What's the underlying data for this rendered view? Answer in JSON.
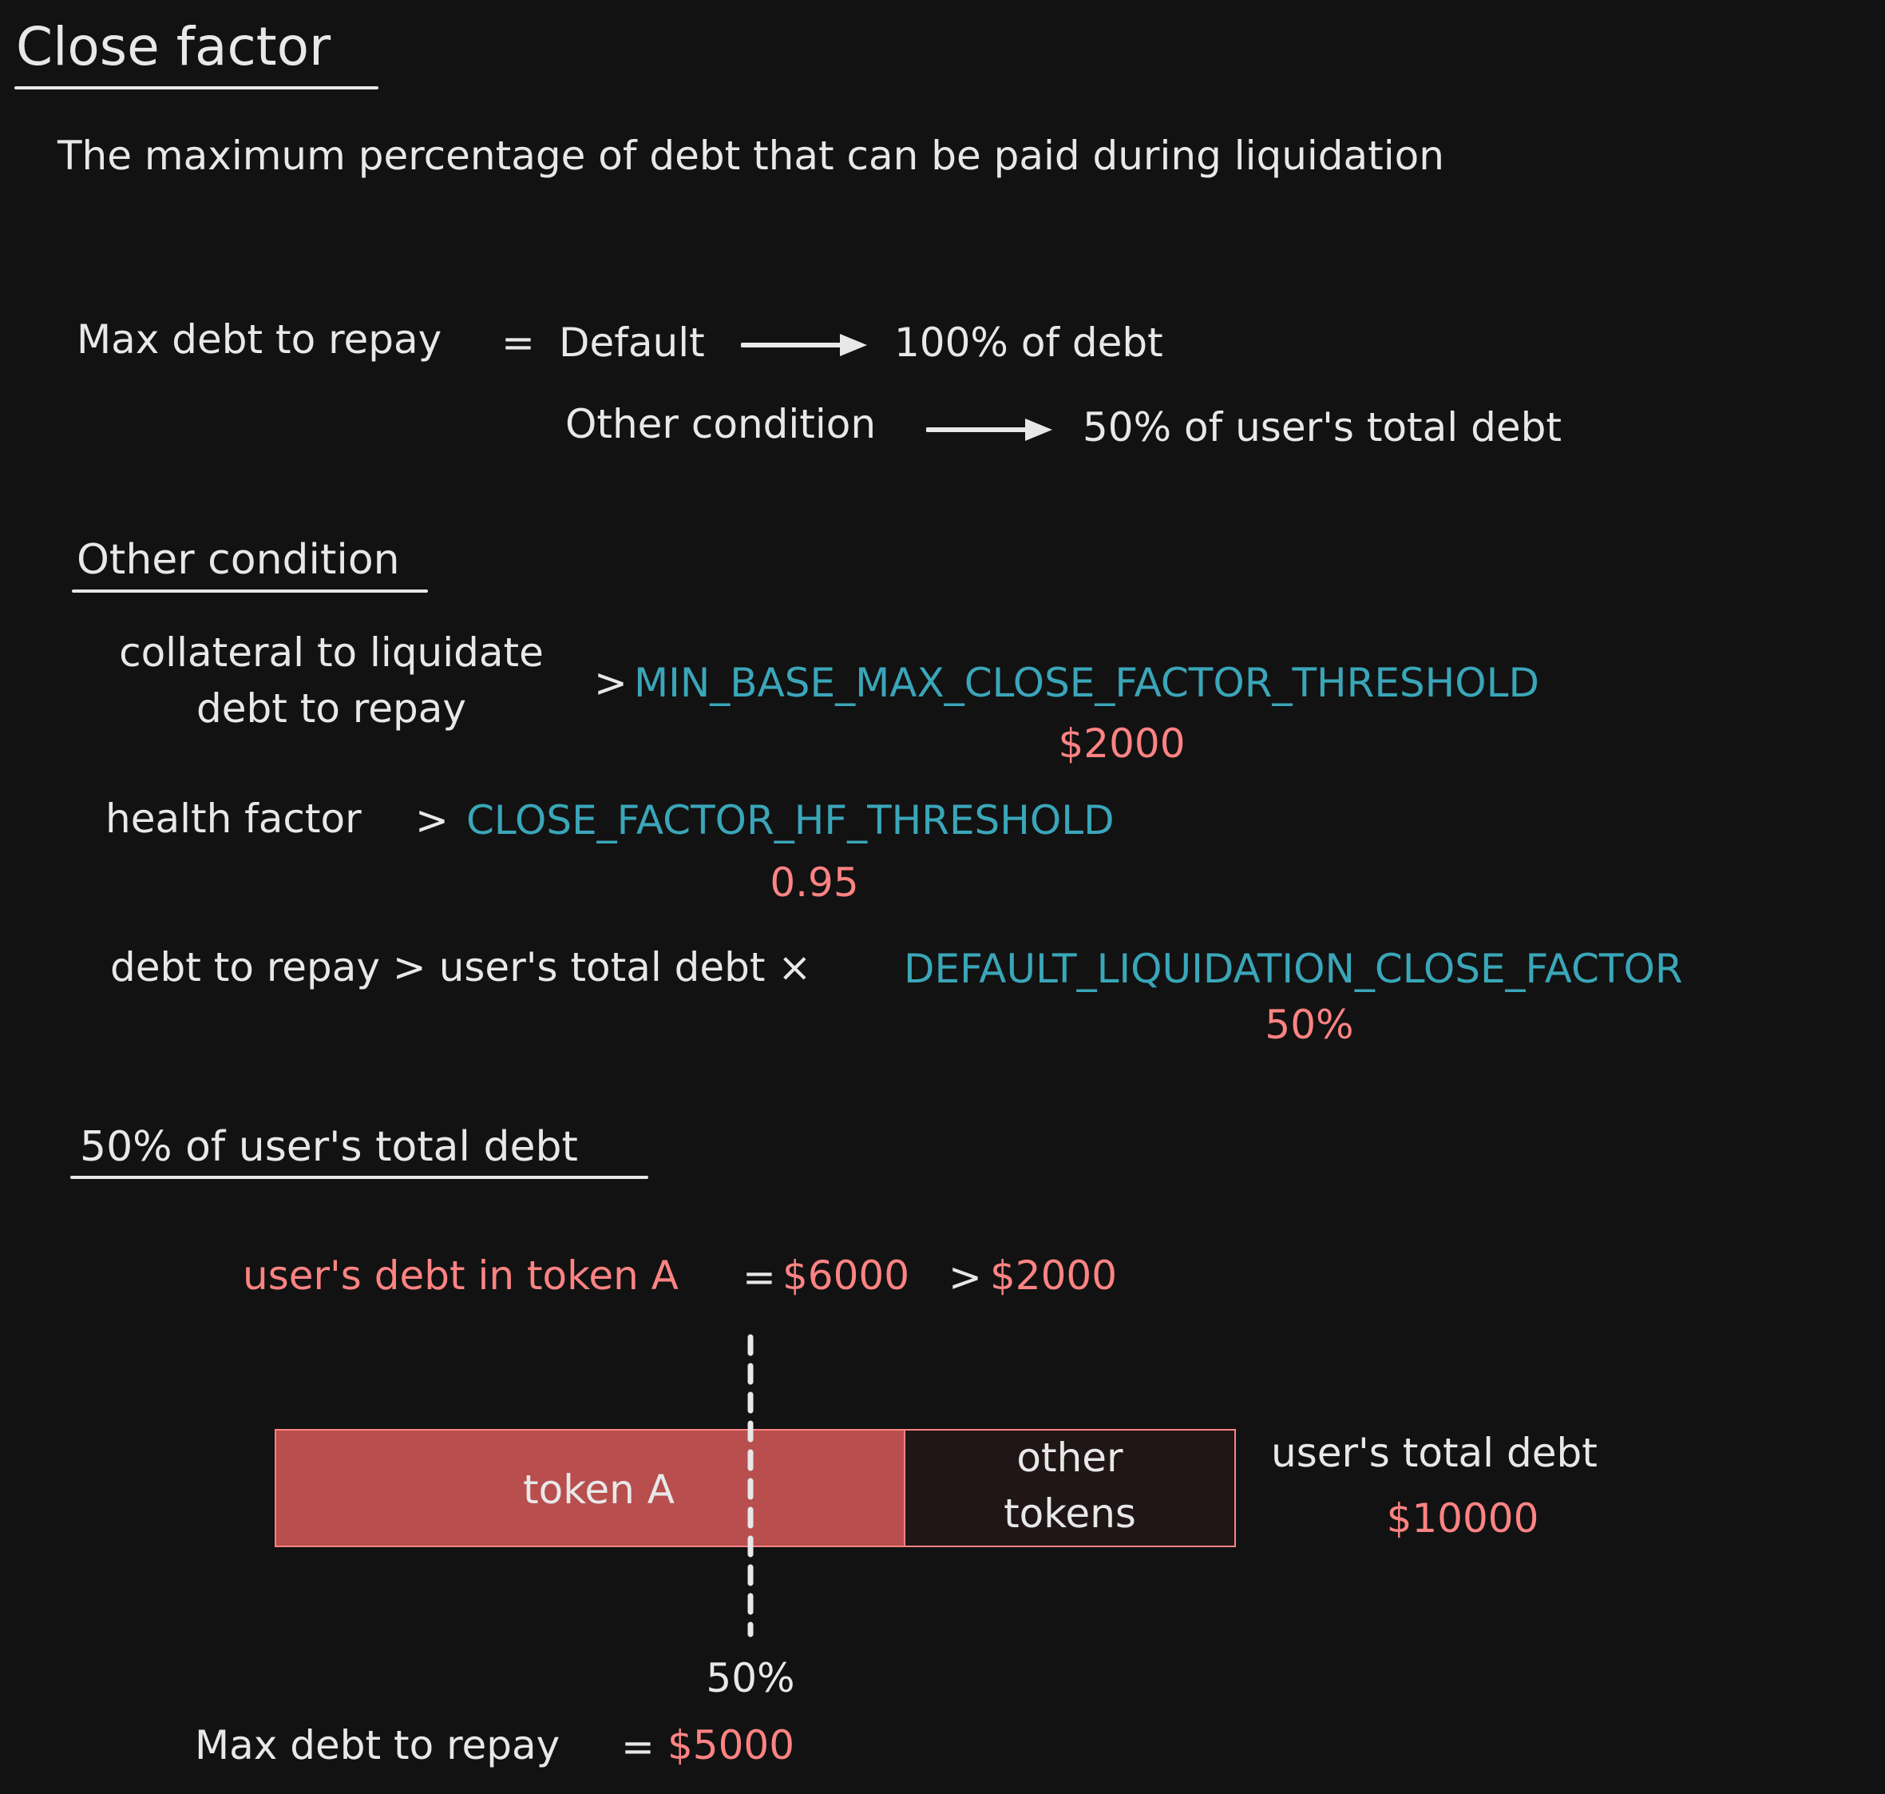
{
  "title": "Close factor",
  "subtitle": "The maximum percentage of debt that can be paid during liquidation",
  "formula": {
    "lhs": "Max debt to repay",
    "eq": "=",
    "default_label": "Default",
    "default_result": "100% of debt",
    "other_label": "Other condition",
    "other_result": "50% of user's total debt"
  },
  "other_condition": {
    "heading": "Other condition",
    "cond1_line1": "collateral to liquidate",
    "cond1_line2": "debt to repay",
    "cond1_op": ">",
    "cond1_const": "MIN_BASE_MAX_CLOSE_FACTOR_THRESHOLD",
    "cond1_value": "$2000",
    "cond2_lhs": "health factor",
    "cond2_op": ">",
    "cond2_const": "CLOSE_FACTOR_HF_THRESHOLD",
    "cond2_value": "0.95",
    "cond3_lhs": "debt to repay > user's total debt ×",
    "cond3_const": "DEFAULT_LIQUIDATION_CLOSE_FACTOR",
    "cond3_value": "50%"
  },
  "example": {
    "heading": "50% of user's total debt",
    "debt_label": "user's debt in token A",
    "debt_eq": "=",
    "debt_value": "$6000",
    "debt_gt": ">",
    "debt_threshold": "$2000",
    "bar_token_a": "token A",
    "bar_other_line1": "other",
    "bar_other_line2": "tokens",
    "total_label": "user's total debt",
    "total_value": "$10000",
    "half_marker": "50%",
    "max_label": "Max debt to repay",
    "max_eq": "=",
    "max_value": "$5000"
  },
  "colors": {
    "background": "#121212",
    "text": "#e8e8e8",
    "constant": "#3aa6b9",
    "value": "#ff8383",
    "bar_fill": "#b84e4e",
    "bar_other_fill": "#211617"
  }
}
